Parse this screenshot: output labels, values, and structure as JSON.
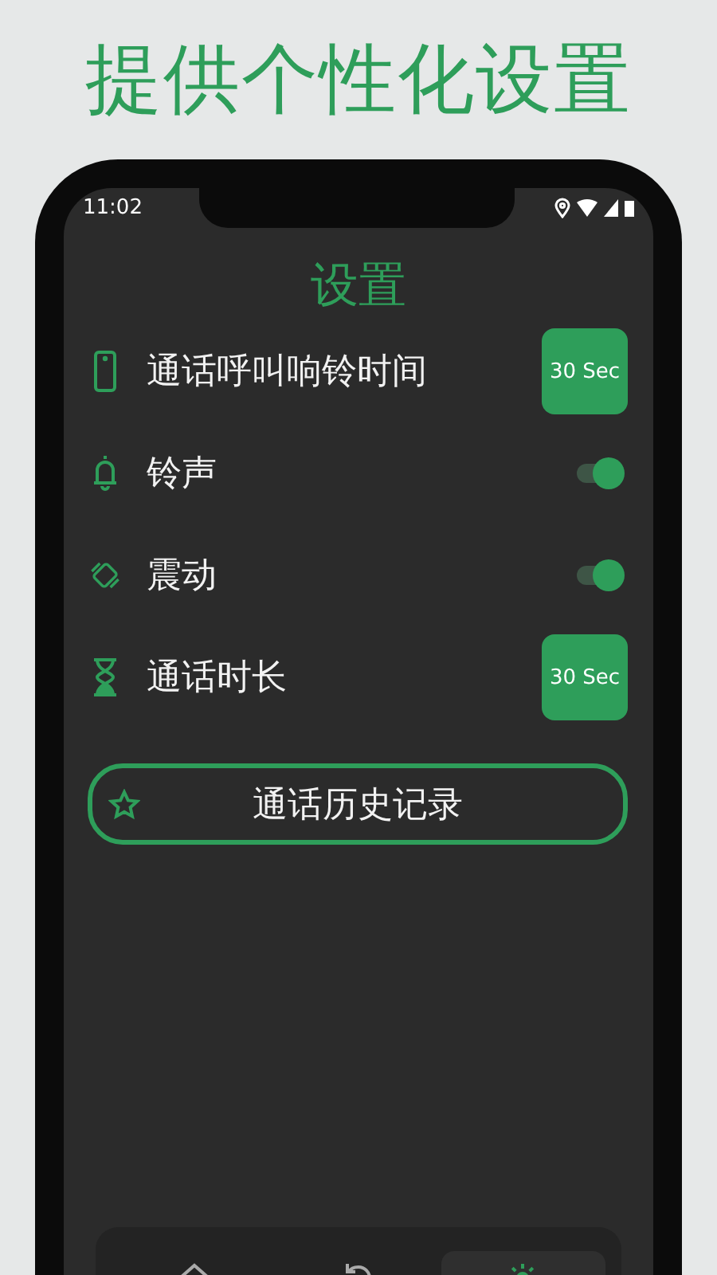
{
  "headline": "提供个性化设置",
  "status_bar": {
    "time": "11:02"
  },
  "screen": {
    "title": "设置",
    "settings": [
      {
        "kind": "value",
        "label": "通话呼叫响铃时间",
        "value": "30 Sec"
      },
      {
        "kind": "toggle",
        "label": "铃声",
        "on": true
      },
      {
        "kind": "toggle",
        "label": "震动",
        "on": true
      },
      {
        "kind": "value",
        "label": "通话时长",
        "value": "30 Sec"
      }
    ],
    "history_button": {
      "label": "通话历史记录"
    },
    "nav": [
      {
        "selected": false
      },
      {
        "selected": false
      },
      {
        "selected": true
      }
    ]
  }
}
